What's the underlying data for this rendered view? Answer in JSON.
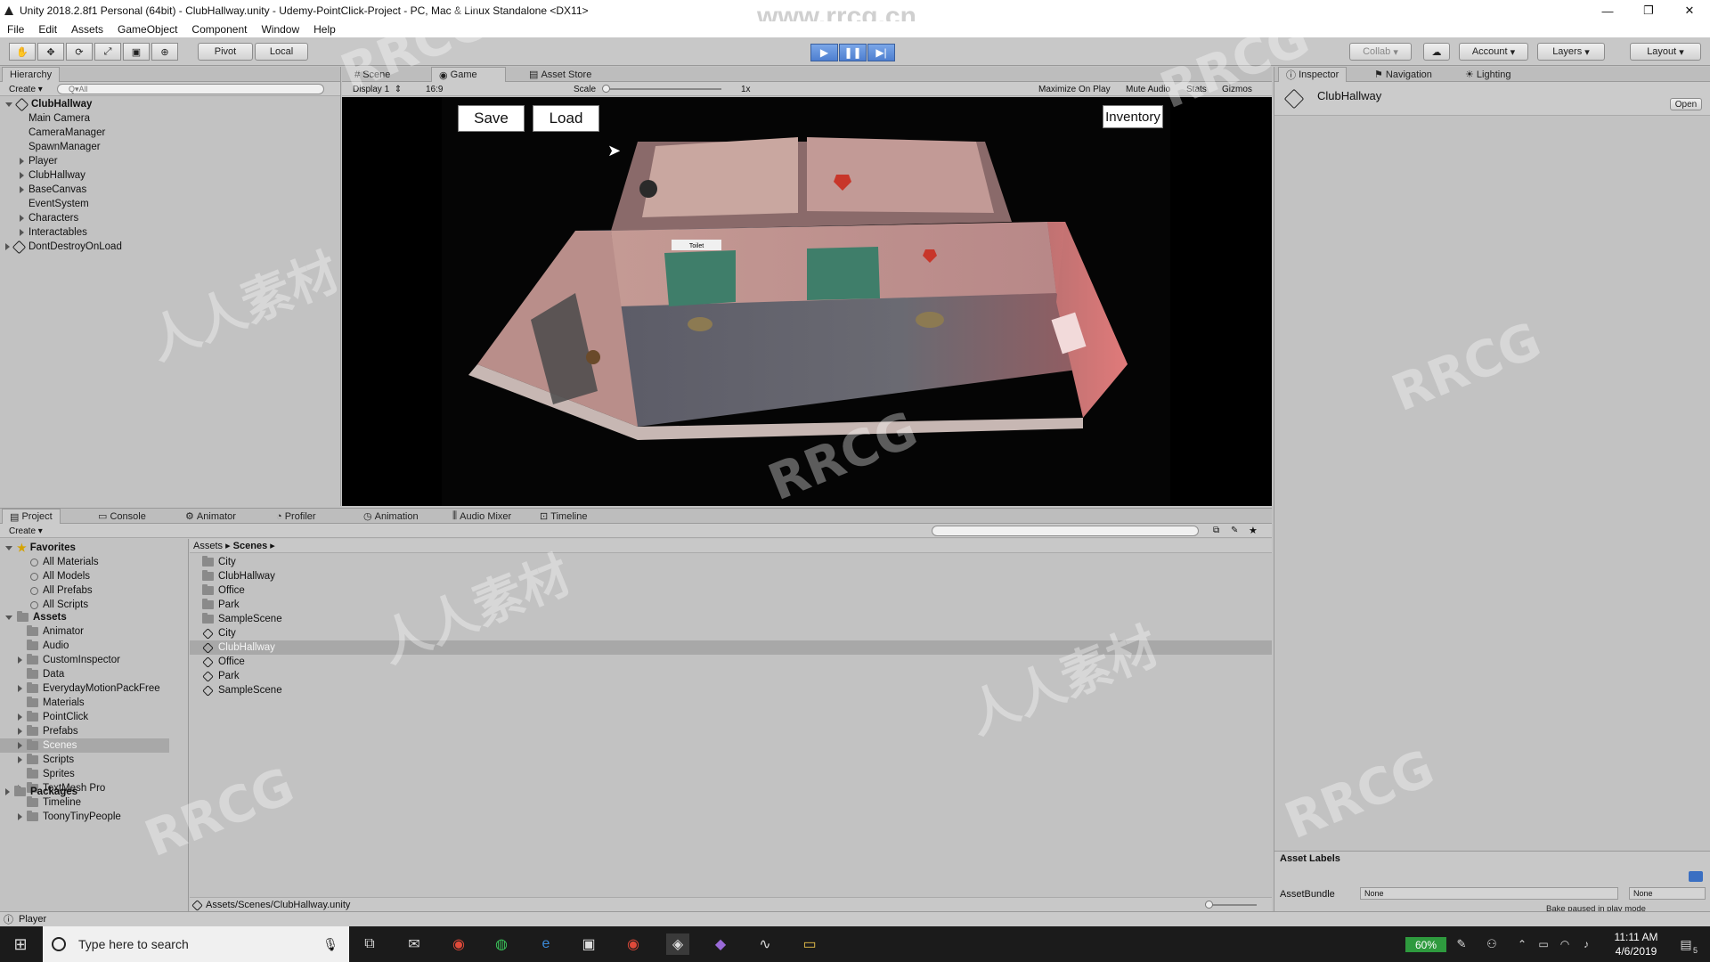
{
  "window": {
    "title": "Unity 2018.2.8f1 Personal (64bit) - ClubHallway.unity - Udemy-PointClick-Project - PC, Mac & Linux Standalone <DX11>",
    "watermark_url": "www.rrcg.cn"
  },
  "menu": [
    "File",
    "Edit",
    "Assets",
    "GameObject",
    "Component",
    "Window",
    "Help"
  ],
  "toolbar": {
    "pivot": "Pivot",
    "local": "Local",
    "collab": "Collab",
    "account": "Account",
    "layers": "Layers",
    "layout": "Layout"
  },
  "hierarchy": {
    "tab": "Hierarchy",
    "create": "Create",
    "search_placeholder": "Q▾All",
    "scene": "ClubHallway",
    "items": [
      {
        "label": "Main Camera",
        "expand": false
      },
      {
        "label": "CameraManager",
        "expand": false
      },
      {
        "label": "SpawnManager",
        "expand": false
      },
      {
        "label": "Player",
        "expand": true
      },
      {
        "label": "ClubHallway",
        "expand": true
      },
      {
        "label": "BaseCanvas",
        "expand": true
      },
      {
        "label": "EventSystem",
        "expand": false
      },
      {
        "label": "Characters",
        "expand": true
      },
      {
        "label": "Interactables",
        "expand": true
      }
    ],
    "dontdestroy": "DontDestroyOnLoad"
  },
  "views": {
    "tabs": [
      "Scene",
      "Game",
      "Asset Store"
    ],
    "display": "Display 1",
    "aspect": "16:9",
    "scale_label": "Scale",
    "scale_value": "1x",
    "maximize": "Maximize On Play",
    "mute": "Mute Audio",
    "stats": "Stats",
    "gizmos": "Gizmos"
  },
  "game": {
    "save": "Save",
    "load": "Load",
    "inventory": "Inventory",
    "sign": "Toilet"
  },
  "inspector": {
    "tabs": [
      "Inspector",
      "Navigation",
      "Lighting"
    ],
    "object": "ClubHallway",
    "open": "Open",
    "asset_labels": "Asset Labels",
    "assetbundle": "AssetBundle",
    "none1": "None",
    "none2": "None",
    "bake_note": "Bake paused in play mode"
  },
  "bottom": {
    "tabs": [
      "Project",
      "Console",
      "Animator",
      "Profiler",
      "Animation",
      "Audio Mixer",
      "Timeline"
    ],
    "create": "Create",
    "favorites": "Favorites",
    "fav_items": [
      "All Materials",
      "All Models",
      "All Prefabs",
      "All Scripts"
    ],
    "assets": "Assets",
    "asset_folders": [
      {
        "label": "Animator",
        "expand": false
      },
      {
        "label": "Audio",
        "expand": false
      },
      {
        "label": "CustomInspector",
        "expand": true
      },
      {
        "label": "Data",
        "expand": false
      },
      {
        "label": "EverydayMotionPackFree",
        "expand": true
      },
      {
        "label": "Materials",
        "expand": false
      },
      {
        "label": "PointClick",
        "expand": true
      },
      {
        "label": "Prefabs",
        "expand": true
      },
      {
        "label": "Scenes",
        "expand": true
      },
      {
        "label": "Scripts",
        "expand": true
      },
      {
        "label": "Sprites",
        "expand": false
      },
      {
        "label": "TextMesh Pro",
        "expand": true
      },
      {
        "label": "Timeline",
        "expand": false
      },
      {
        "label": "ToonyTinyPeople",
        "expand": true
      }
    ],
    "packages": "Packages",
    "breadcrumb": [
      "Assets",
      "Scenes"
    ],
    "content": [
      {
        "label": "City",
        "kind": "folder"
      },
      {
        "label": "ClubHallway",
        "kind": "folder"
      },
      {
        "label": "Office",
        "kind": "folder"
      },
      {
        "label": "Park",
        "kind": "folder"
      },
      {
        "label": "SampleScene",
        "kind": "folder"
      },
      {
        "label": "City",
        "kind": "scene"
      },
      {
        "label": "ClubHallway",
        "kind": "scene"
      },
      {
        "label": "Office",
        "kind": "scene"
      },
      {
        "label": "Park",
        "kind": "scene"
      },
      {
        "label": "SampleScene",
        "kind": "scene"
      }
    ],
    "path": "Assets/Scenes/ClubHallway.unity"
  },
  "status": {
    "text": "Player"
  },
  "taskbar": {
    "search": "Type here to search",
    "battery": "60%",
    "time": "11:11 AM",
    "date": "4/6/2019",
    "notif": "5"
  },
  "overlay_text": [
    "RRCG",
    "人人素材"
  ]
}
